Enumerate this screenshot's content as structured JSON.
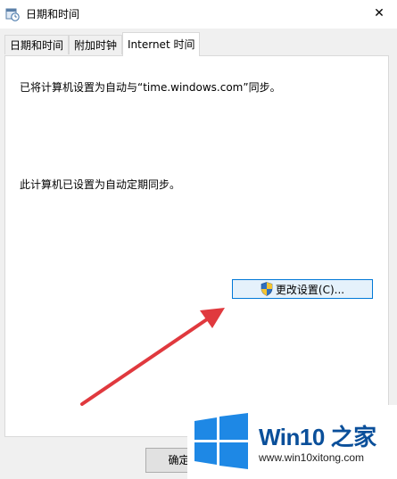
{
  "window": {
    "title": "日期和时间",
    "close_symbol": "✕"
  },
  "tabs": [
    {
      "label": "日期和时间"
    },
    {
      "label": "附加时钟"
    },
    {
      "label": "Internet 时间"
    }
  ],
  "panel": {
    "sync_text": "已将计算机设置为自动与“time.windows.com”同步。",
    "schedule_text": "此计算机已设置为自动定期同步。",
    "change_button": "更改设置(C)..."
  },
  "footer": {
    "ok_label": "确定"
  },
  "watermark": {
    "brand": "Win10",
    "brand_suffix": "之家",
    "site": "www.win10xitong.com"
  },
  "colors": {
    "accent": "#0078d7",
    "arrow": "#e0393e",
    "brand": "#0a4f9a"
  }
}
